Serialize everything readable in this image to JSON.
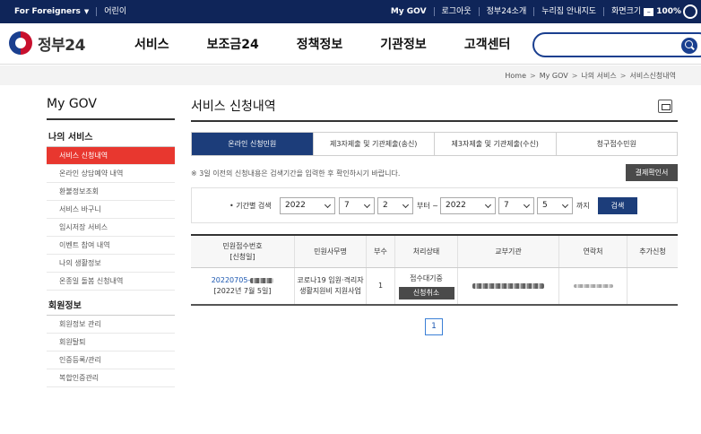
{
  "utilbar": {
    "foreigners": "For Foreigners",
    "accessibility_label": "어린이",
    "my_gov": "My GOV",
    "logout": "로그아웃",
    "intro": "정부24소개",
    "guide": "누리집 안내지도",
    "font_size": "화면크기",
    "zoom_minus": "–",
    "zoom_value": "100%"
  },
  "header": {
    "logo_text": "정부24",
    "nav": [
      "서비스",
      "보조금24",
      "정책정보",
      "기관정보",
      "고객센터"
    ],
    "search_placeholder": ""
  },
  "breadcrumb": [
    "Home",
    "My GOV",
    "나의 서비스",
    "서비스신청내역"
  ],
  "sidebar": {
    "title": "My GOV",
    "section1": "나의 서비스",
    "items1": [
      "서비스 신청내역",
      "온라인 상담예약 내역",
      "환불정보조회",
      "서비스 바구니",
      "임시저장 서비스",
      "이벤트 참여 내역",
      "나의 생활정보",
      "온종일 돌봄 신청내역"
    ],
    "section2": "회원정보",
    "items2": [
      "회원정보 관리",
      "회원탈퇴",
      "인증등록/관리",
      "복합인증관리"
    ]
  },
  "main": {
    "title": "서비스 신청내역",
    "tabs": [
      "온라인 신청민원",
      "제3자제출 및 기관제출(송신)",
      "제3자제출 및 기관제출(수신)",
      "청구접수민원"
    ],
    "notice": "※ 3일 이전의 신청내용은 검색기간을 입력한 후 확인하시기 바랍니다.",
    "receipt_button": "결제확인서",
    "filter": {
      "label": "• 기간별 검색",
      "from_year": "2022",
      "from_month": "7",
      "from_day": "2",
      "from_text": "부터 ~",
      "to_year": "2022",
      "to_month": "7",
      "to_day": "5",
      "to_text": "까지",
      "search_button": "검색"
    },
    "table": {
      "headers": [
        "민원접수번호\n[신청일]",
        "민원사무명",
        "부수",
        "처리상태",
        "교부기관",
        "연락처",
        "추가신청"
      ],
      "row": {
        "receipt_no": "20220705-",
        "date": "[2022년 7월 5일]",
        "service_name": "코로나19 입원·격리자 생활지원비 지원사업",
        "copies": "1",
        "status": "접수대기중",
        "cancel_button": "신청취소"
      }
    },
    "pager": [
      "1"
    ]
  }
}
